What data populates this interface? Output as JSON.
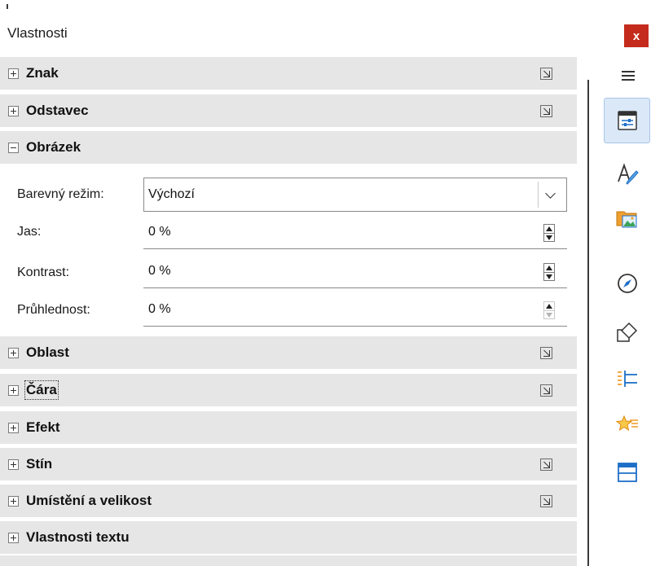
{
  "window": {
    "title": "Vlastnosti",
    "close_label": "x"
  },
  "sections": [
    {
      "id": "znak",
      "label": "Znak",
      "expanded": false,
      "has_more": true
    },
    {
      "id": "odstavec",
      "label": "Odstavec",
      "expanded": false,
      "has_more": true
    },
    {
      "id": "obrazek",
      "label": "Obrázek",
      "expanded": true,
      "has_more": false
    },
    {
      "id": "oblast",
      "label": "Oblast",
      "expanded": false,
      "has_more": true
    },
    {
      "id": "cara",
      "label": "Čára",
      "expanded": false,
      "has_more": true
    },
    {
      "id": "efekt",
      "label": "Efekt",
      "expanded": false,
      "has_more": false
    },
    {
      "id": "stin",
      "label": "Stín",
      "expanded": false,
      "has_more": true
    },
    {
      "id": "umisteni",
      "label": "Umístění a velikost",
      "expanded": false,
      "has_more": true
    },
    {
      "id": "vlastnosti_textu",
      "label": "Vlastnosti textu",
      "expanded": false,
      "has_more": false
    }
  ],
  "image_panel": {
    "color_mode": {
      "label": "Barevný režim:",
      "value": "Výchozí"
    },
    "brightness": {
      "label": "Jas:",
      "value": "0 %"
    },
    "contrast": {
      "label": "Kontrast:",
      "value": "0 %"
    },
    "transparency": {
      "label": "Průhlednost:",
      "value": "0 %"
    }
  },
  "tabbar": {
    "menu_icon": "hamburger-menu-icon",
    "tabs": [
      {
        "id": "properties",
        "icon": "properties-icon",
        "active": true
      },
      {
        "id": "styles",
        "icon": "styles-icon",
        "active": false
      },
      {
        "id": "gallery",
        "icon": "gallery-icon",
        "active": false
      },
      {
        "id": "navigator",
        "icon": "navigator-icon",
        "active": false
      },
      {
        "id": "shapes",
        "icon": "shapes-icon",
        "active": false
      },
      {
        "id": "page",
        "icon": "page-format-icon",
        "active": false
      },
      {
        "id": "style-inspector",
        "icon": "style-inspector-icon",
        "active": false
      },
      {
        "id": "manage-changes",
        "icon": "manage-changes-icon",
        "active": false
      }
    ]
  },
  "colors": {
    "header_bg": "#e6e6e6",
    "close_bg": "#c42b1c",
    "active_tab_bg": "#dbe8f7",
    "icon_blue": "#1e6fc7",
    "icon_orange": "#f0a030"
  }
}
